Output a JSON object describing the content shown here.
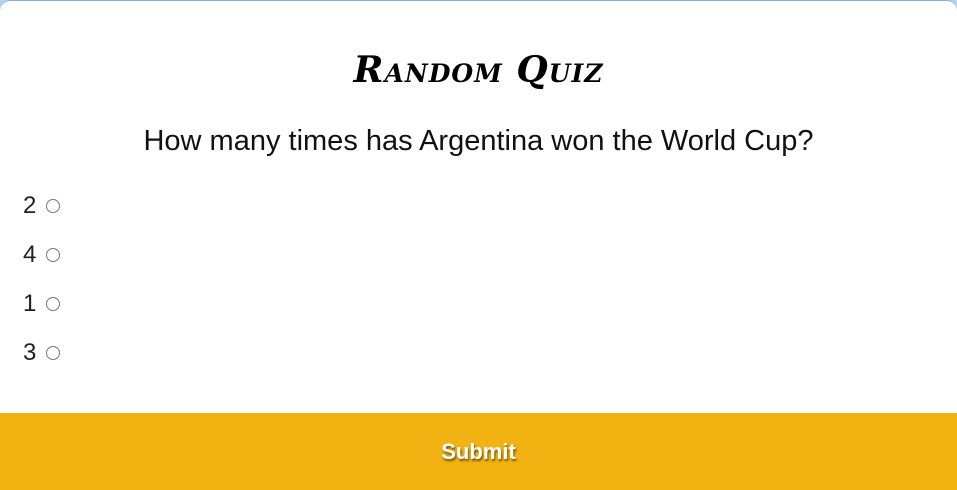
{
  "quiz": {
    "title": "Random Quiz",
    "question": "How many times has Argentina won the World Cup?",
    "answers": [
      {
        "label": "2"
      },
      {
        "label": "4"
      },
      {
        "label": "1"
      },
      {
        "label": "3"
      }
    ],
    "submit_label": "Submit"
  },
  "colors": {
    "submit_background": "#f2b211",
    "card_background": "#ffffff"
  }
}
